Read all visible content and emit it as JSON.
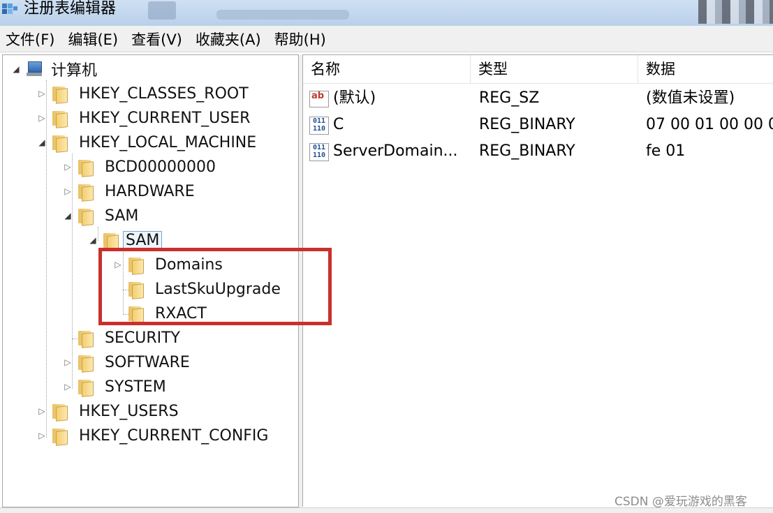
{
  "window": {
    "title": "注册表编辑器"
  },
  "menu": [
    {
      "label": "文件(F)"
    },
    {
      "label": "编辑(E)"
    },
    {
      "label": "查看(V)"
    },
    {
      "label": "收藏夹(A)"
    },
    {
      "label": "帮助(H)"
    }
  ],
  "tree": {
    "root_label": "计算机",
    "nodes": [
      {
        "label": "HKEY_CLASSES_ROOT",
        "expanded": false
      },
      {
        "label": "HKEY_CURRENT_USER",
        "expanded": false
      },
      {
        "label": "HKEY_LOCAL_MACHINE",
        "expanded": true
      },
      {
        "label": "BCD00000000",
        "expanded": false
      },
      {
        "label": "HARDWARE",
        "expanded": false
      },
      {
        "label": "SAM",
        "expanded": true
      },
      {
        "label": "SAM",
        "expanded": true,
        "selected": true
      },
      {
        "label": "Domains",
        "expanded": false
      },
      {
        "label": "LastSkuUpgrade"
      },
      {
        "label": "RXACT"
      },
      {
        "label": "SECURITY"
      },
      {
        "label": "SOFTWARE",
        "expanded": false
      },
      {
        "label": "SYSTEM",
        "expanded": false
      },
      {
        "label": "HKEY_USERS",
        "expanded": false
      },
      {
        "label": "HKEY_CURRENT_CONFIG",
        "expanded": false
      }
    ]
  },
  "list": {
    "columns": [
      "名称",
      "类型",
      "数据"
    ],
    "rows": [
      {
        "icon": "string-value-icon",
        "name": "(默认)",
        "type": "REG_SZ",
        "data": "(数值未设置)"
      },
      {
        "icon": "binary-value-icon",
        "name": "C",
        "type": "REG_BINARY",
        "data": "07 00 01 00 00 0"
      },
      {
        "icon": "binary-value-icon",
        "name": "ServerDomain...",
        "type": "REG_BINARY",
        "data": "fe 01"
      }
    ]
  },
  "highlight_color": "#c9302c",
  "watermark": "CSDN @爱玩游戏的黑客"
}
